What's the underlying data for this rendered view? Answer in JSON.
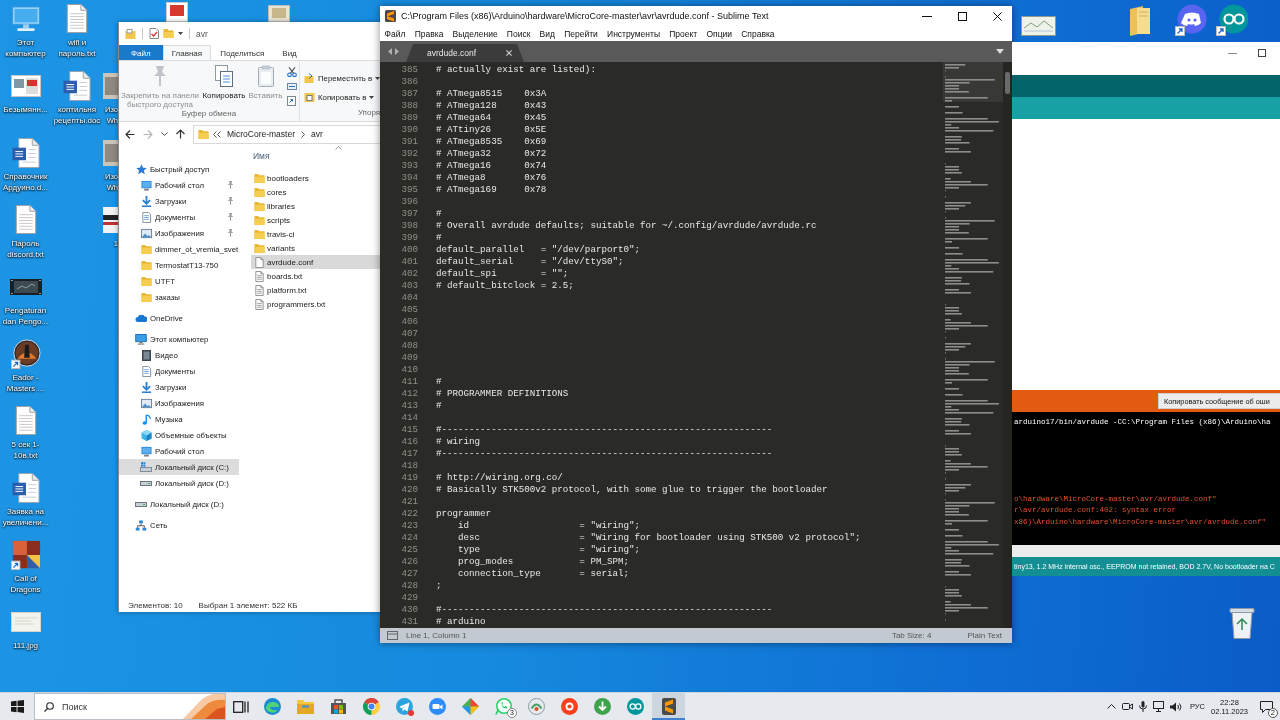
{
  "desktop": {
    "columns": [
      {
        "icons": [
          {
            "label": "Этот компьютер",
            "kind": "computer",
            "shortcut": false
          },
          {
            "label": "Безымянн...",
            "kind": "picture",
            "shortcut": false
          },
          {
            "label": "Справочник Ардуино.d...",
            "kind": "word",
            "shortcut": false
          },
          {
            "label": "Пароль discord.txt",
            "kind": "text",
            "shortcut": false
          },
          {
            "label": "Pengaturan dan Pengo...",
            "kind": "video",
            "shortcut": false
          },
          {
            "label": "Eador - Masters ...",
            "kind": "eador",
            "shortcut": true
          },
          {
            "label": "5 сек 1-10в.txt",
            "kind": "text",
            "shortcut": false
          },
          {
            "label": "Заявка на увеличени...",
            "kind": "word",
            "shortcut": false
          },
          {
            "label": "Call of Dragons",
            "kind": "dragons",
            "shortcut": true
          },
          {
            "label": "111.jpg",
            "kind": "photo",
            "shortcut": false
          }
        ]
      },
      {
        "icons": [
          {
            "label": "wifi и пароль.txt",
            "kind": "text",
            "shortcut": false
          },
          {
            "label": "коптильня рецепты.doc",
            "kind": "word",
            "shortcut": false
          }
        ]
      },
      {
        "icons": [
          {
            "label": "Изо Wh",
            "kind": "partial_image",
            "shortcut": false
          },
          {
            "label": "Изо Wh",
            "kind": "partial_image",
            "shortcut": false
          },
          {
            "label": "1",
            "kind": "partial_photo",
            "shortcut": false
          }
        ]
      }
    ]
  },
  "explorer": {
    "title": "avr",
    "ribbon_tabs": [
      {
        "label": "Файл",
        "kind": "file",
        "selected": false
      },
      {
        "label": "Главная",
        "kind": "tab",
        "selected": true
      },
      {
        "label": "Поделиться",
        "kind": "tab",
        "selected": false
      },
      {
        "label": "Вид",
        "kind": "tab",
        "selected": false
      }
    ],
    "ribbon_groups": [
      {
        "label": "Буфер обмена",
        "kind": "clipboard",
        "buttons": [
          {
            "label": "Закрепить на панели быстрого доступа",
            "kind": "pin",
            "disabled": true
          },
          {
            "label": "Копировать",
            "kind": "copy",
            "disabled": false
          },
          {
            "label": "Вставить",
            "kind": "paste",
            "disabled": true
          }
        ]
      },
      {
        "label": "Упоря",
        "kind": "organize",
        "buttons": [
          {
            "label": "Переместить в",
            "kind": "move",
            "disabled": false
          },
          {
            "label": "Копировать в",
            "kind": "copyto",
            "disabled": false
          }
        ]
      }
    ],
    "address": {
      "path": [
        "MicroCore-master",
        "avr"
      ]
    },
    "column_header": "Имя",
    "nav": [
      {
        "label": "Быстрый доступ",
        "kind": "star",
        "selected": false,
        "children": [
          {
            "label": "Рабочий стол",
            "kind": "desktop",
            "pinned": true,
            "selected": false
          },
          {
            "label": "Загрузки",
            "kind": "downloads",
            "pinned": true,
            "selected": false
          },
          {
            "label": "Документы",
            "kind": "documents",
            "pinned": true,
            "selected": false
          },
          {
            "label": "Изображения",
            "kind": "pictures",
            "pinned": true,
            "selected": false
          },
          {
            "label": "dimmer_ot_vremia_svet",
            "kind": "folder",
            "pinned": false,
            "selected": false
          },
          {
            "label": "TermostatT13-750",
            "kind": "folder",
            "pinned": false,
            "selected": false
          },
          {
            "label": "UTFT",
            "kind": "folder",
            "pinned": false,
            "selected": false
          },
          {
            "label": "заказы",
            "kind": "folder",
            "pinned": false,
            "selected": false
          }
        ]
      },
      {
        "label": "OneDrive",
        "kind": "cloud",
        "selected": false
      },
      {
        "label": "Этот компьютер",
        "kind": "computer",
        "selected": false,
        "children": [
          {
            "label": "Видео",
            "kind": "video",
            "selected": false
          },
          {
            "label": "Документы",
            "kind": "documents",
            "selected": false
          },
          {
            "label": "Загрузки",
            "kind": "downloads",
            "selected": false
          },
          {
            "label": "Изображения",
            "kind": "pictures",
            "selected": false
          },
          {
            "label": "Музыка",
            "kind": "music",
            "selected": false
          },
          {
            "label": "Объемные объекты",
            "kind": "objects3d",
            "selected": false
          },
          {
            "label": "Рабочий стол",
            "kind": "desktop",
            "selected": false
          },
          {
            "label": "Локальный диск (C:)",
            "kind": "system_drive",
            "selected": true
          },
          {
            "label": "Локальный диск (D:)",
            "kind": "drive",
            "selected": false
          }
        ]
      },
      {
        "label": "Локальный диск (D:)",
        "kind": "drive",
        "selected": false
      },
      {
        "label": "Сеть",
        "kind": "network",
        "selected": false
      }
    ],
    "files": [
      {
        "name": "bootloaders",
        "kind": "folder",
        "selected": false
      },
      {
        "name": "cores",
        "kind": "folder",
        "selected": false
      },
      {
        "name": "libraries",
        "kind": "folder",
        "selected": false
      },
      {
        "name": "scripts",
        "kind": "folder",
        "selected": false
      },
      {
        "name": "travis-ci",
        "kind": "folder",
        "selected": false
      },
      {
        "name": "variants",
        "kind": "folder",
        "selected": false
      },
      {
        "name": "avrdude.conf",
        "kind": "file",
        "selected": true
      },
      {
        "name": "boards.txt",
        "kind": "text",
        "selected": false
      },
      {
        "name": "platform.txt",
        "kind": "text",
        "selected": false
      },
      {
        "name": "programmers.txt",
        "kind": "text",
        "selected": false
      }
    ],
    "status_bar": {
      "count": "Элементов: 10",
      "selection": "Выбран 1 элемент: 522 КБ"
    }
  },
  "sublime": {
    "title": "C:\\Program Files (x86)\\Arduino\\hardware\\MicroCore-master\\avr\\avrdude.conf - Sublime Text",
    "menu": [
      "Файл",
      "Правка",
      "Выделение",
      "Поиск",
      "Вид",
      "Перейти",
      "Инструменты",
      "Проект",
      "Опции",
      "Справка"
    ],
    "tabs": [
      {
        "label": "avrdude.conf",
        "selected": true
      }
    ],
    "lines": [
      {
        "number": "385",
        "text": "# actually exist are listed):"
      },
      {
        "number": "386"
      },
      {
        "number": "387",
        "text": "# ATmega8515    0x3A"
      },
      {
        "number": "388",
        "text": "# ATmega128     0x43"
      },
      {
        "number": "389",
        "text": "# ATmega64      0x45"
      },
      {
        "number": "390",
        "text": "# ATtiny26      0x5E"
      },
      {
        "number": "391",
        "text": "# ATmega8535    0x69"
      },
      {
        "number": "392",
        "text": "# ATmega32      0x72"
      },
      {
        "number": "393",
        "text": "# ATmega16      0x74"
      },
      {
        "number": "394",
        "text": "# ATmega8       0x76"
      },
      {
        "number": "395",
        "text": "# ATmega169     0x78"
      },
      {
        "number": "396"
      },
      {
        "number": "397",
        "text": "#"
      },
      {
        "number": "398",
        "text": "# Overall avrdude defaults; suitable for ~/.config/avrdude/avrdude.rc"
      },
      {
        "number": "399",
        "text": "#"
      },
      {
        "number": "400",
        "text": "default_parallel   = \"/dev/parport0\";"
      },
      {
        "number": "401",
        "text": "default_serial     = \"/dev/ttyS0\";"
      },
      {
        "number": "402",
        "text": "default_spi        = \"\";"
      },
      {
        "number": "403",
        "text": "# default_bitclock = 2.5;"
      },
      {
        "number": "404"
      },
      {
        "number": "405"
      },
      {
        "number": "406"
      },
      {
        "number": "407"
      },
      {
        "number": "408"
      },
      {
        "number": "409"
      },
      {
        "number": "410"
      },
      {
        "number": "411",
        "text": "#"
      },
      {
        "number": "412",
        "text": "# PROGRAMMER DEFINITIONS"
      },
      {
        "number": "413",
        "text": "#"
      },
      {
        "number": "414"
      },
      {
        "number": "415",
        "text": "#------------------------------------------------------------"
      },
      {
        "number": "416",
        "text": "# wiring"
      },
      {
        "number": "417",
        "text": "#------------------------------------------------------------"
      },
      {
        "number": "418"
      },
      {
        "number": "419",
        "text": "# http://wiring.org.co/"
      },
      {
        "number": "420",
        "text": "# Basically STK500v2 protocol, with some glue to trigger the bootloader"
      },
      {
        "number": "421"
      },
      {
        "number": "422",
        "text": "programmer"
      },
      {
        "number": "423",
        "text": "    id                    = \"wiring\";"
      },
      {
        "number": "424",
        "text": "    desc                  = \"Wiring for bootloader using STK500 v2 protocol\";"
      },
      {
        "number": "425",
        "text": "    type                  = \"wiring\";"
      },
      {
        "number": "426",
        "text": "    prog_modes            = PM_SPM;"
      },
      {
        "number": "427",
        "text": "    connection_type       = serial;"
      },
      {
        "number": "428",
        "text": ";"
      },
      {
        "number": "429"
      },
      {
        "number": "430",
        "text": "#------------------------------------------------------------"
      },
      {
        "number": "431",
        "text": "# arduino"
      }
    ],
    "status_bar": {
      "position": "Line 1, Column 1",
      "tab_size": "Tab Size: 4",
      "syntax": "Plain Text"
    }
  },
  "arduino": {
    "error_button": "Копировать сообщение об оши",
    "console": [
      {
        "text": "arduino17/bin/avrdude -CC:\\Program Files (x86)\\Arduino\\ha",
        "kind": "output"
      },
      {
        "text": "o\\hardware\\MicroCore-master\\avr/avrdude.conf\"",
        "kind": "error"
      },
      {
        "text": "r\\avr/avrdude.conf:402: syntax error",
        "kind": "error"
      },
      {
        "text": "x86)\\Arduino\\hardware\\MicroCore-master\\avr/avrdude.conf\"",
        "kind": "error"
      }
    ],
    "status_bar": "tiny13, 1.2 MHz internal osc., EEPROM not retained, BOD 2.7V, No bootloader на C"
  },
  "taskbar": {
    "search": {
      "placeholder": "Поиск"
    },
    "apps": [
      {
        "kind": "taskview",
        "active": false
      },
      {
        "kind": "edge",
        "active": false
      },
      {
        "kind": "explorer",
        "active": false
      },
      {
        "kind": "store",
        "active": false
      },
      {
        "kind": "chrome",
        "active": false
      },
      {
        "kind": "telegram",
        "active": false
      },
      {
        "kind": "zoom",
        "active": false
      },
      {
        "kind": "diamond",
        "active": false
      },
      {
        "kind": "whatsapp",
        "active": false,
        "badge": "3"
      },
      {
        "kind": "disc",
        "active": false
      },
      {
        "kind": "yandex",
        "active": false
      },
      {
        "kind": "download",
        "active": false
      },
      {
        "kind": "arduino",
        "active": false
      },
      {
        "kind": "sublime",
        "active": true
      }
    ],
    "tray": {
      "language": "РУС",
      "time": "22:28",
      "date": "02.11.2023",
      "notifications": "2"
    }
  }
}
